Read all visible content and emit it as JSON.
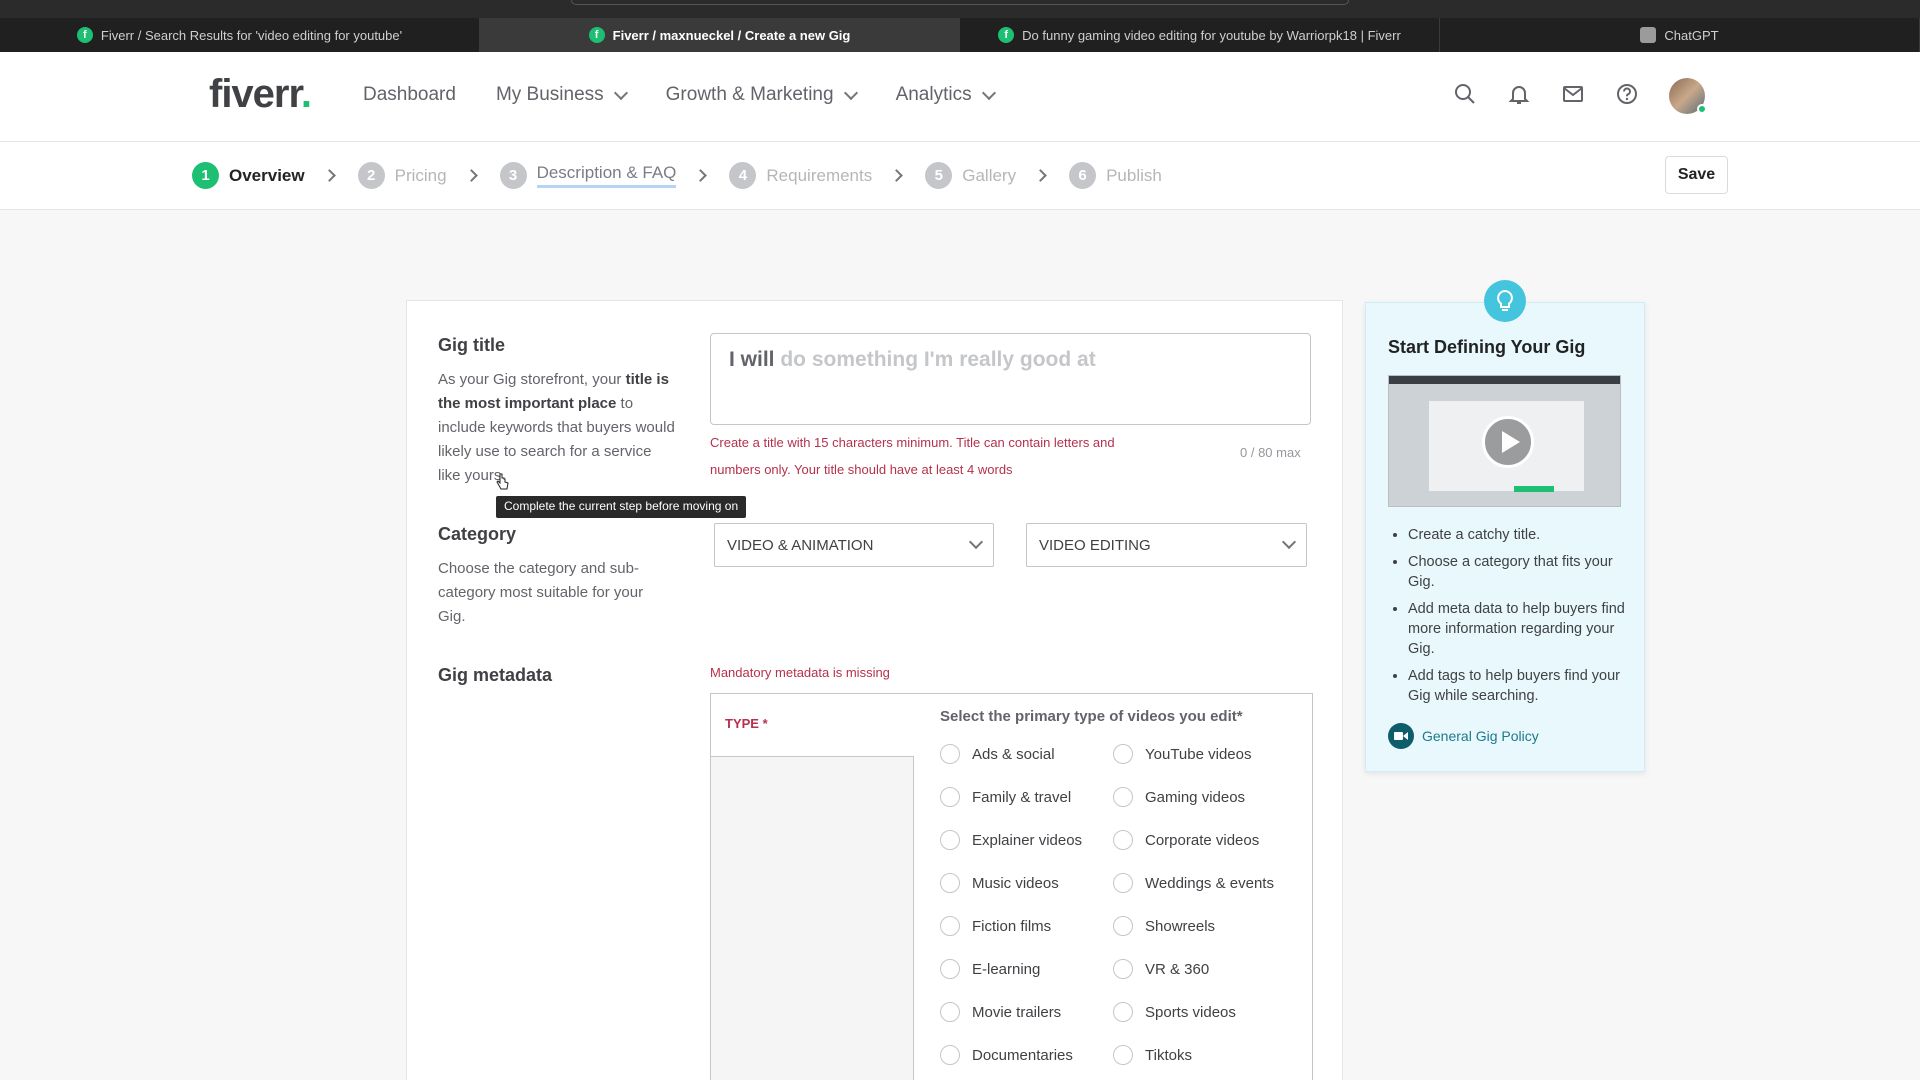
{
  "browser": {
    "tabs": [
      {
        "title": "Fiverr / Search Results for 'video editing for youtube'",
        "favicon": "fiverr-icon"
      },
      {
        "title": "Fiverr / maxnueckel / Create a new Gig",
        "favicon": "fiverr-icon"
      },
      {
        "title": "Do funny gaming video editing for youtube by Warriorpk18 | Fiverr",
        "favicon": "fiverr-icon"
      },
      {
        "title": "ChatGPT",
        "favicon": "chatgpt-icon"
      }
    ]
  },
  "header": {
    "logo": "fiverr",
    "logo_dot": ".",
    "nav": [
      "Dashboard",
      "My Business",
      "Growth & Marketing",
      "Analytics"
    ]
  },
  "stepper": {
    "steps": [
      {
        "num": "1",
        "label": "Overview"
      },
      {
        "num": "2",
        "label": "Pricing"
      },
      {
        "num": "3",
        "label": "Description & FAQ"
      },
      {
        "num": "4",
        "label": "Requirements"
      },
      {
        "num": "5",
        "label": "Gallery"
      },
      {
        "num": "6",
        "label": "Publish"
      }
    ],
    "save_label": "Save"
  },
  "gig_title": {
    "heading": "Gig title",
    "desc_1": "As your Gig storefront, your ",
    "desc_bold": "title is the most important place",
    "desc_2": " to include keywords that buyers would likely use to search for a service like yours.",
    "prefix": "I will",
    "placeholder": "do something I'm really good at",
    "error_1": "Create a title with 15 characters minimum. Title can contain letters and",
    "error_2": "numbers only. Your title should have at least 4 words",
    "counter": "0 / 80 max",
    "tooltip": "Complete the current step before moving on"
  },
  "category": {
    "heading": "Category",
    "desc": "Choose the category and sub-category most suitable for your Gig.",
    "main": "VIDEO & ANIMATION",
    "sub": "VIDEO EDITING"
  },
  "metadata": {
    "heading": "Gig metadata",
    "error": "Mandatory metadata is missing",
    "type_label": "TYPE *",
    "question": "Select the primary type of videos you edit*",
    "options_left": [
      "Ads & social",
      "Family & travel",
      "Explainer videos",
      "Music videos",
      "Fiction films",
      "E-learning",
      "Movie trailers",
      "Documentaries"
    ],
    "options_right": [
      "YouTube videos",
      "Gaming videos",
      "Corporate videos",
      "Weddings & events",
      "Showreels",
      "VR & 360",
      "Sports videos",
      "Tiktoks"
    ]
  },
  "side_panel": {
    "title": "Start Defining Your Gig",
    "tips": [
      "Create a catchy title.",
      "Choose a category that fits your Gig.",
      "Add meta data to help buyers find more information regarding your Gig.",
      "Add tags to help buyers find your Gig while searching."
    ],
    "policy_link": "General Gig Policy"
  },
  "colors": {
    "brand_green": "#1dbf73",
    "error_red": "#b5314c",
    "panel_bg": "#e8f8fc",
    "accent_cyan": "#45c5dd"
  }
}
